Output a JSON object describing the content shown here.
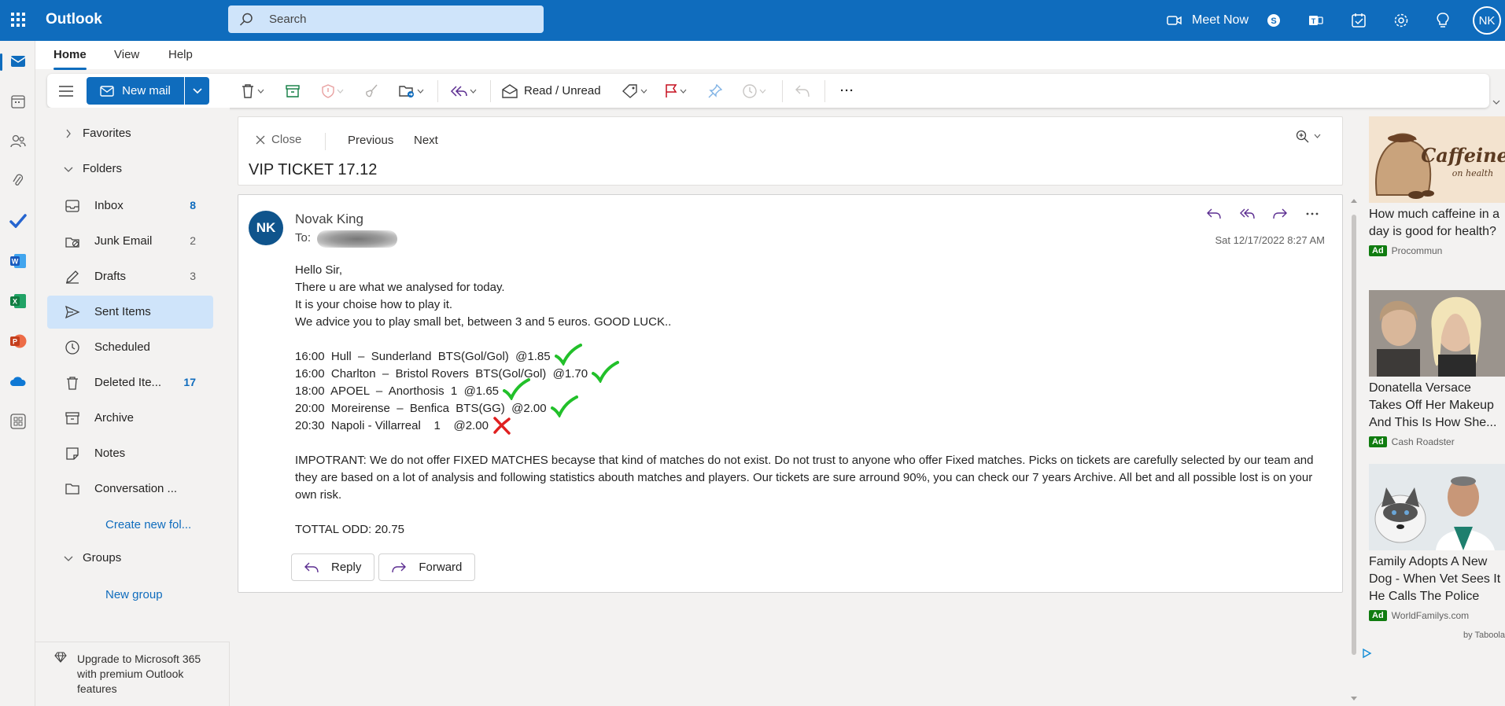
{
  "app": {
    "name": "Outlook"
  },
  "search": {
    "placeholder": "Search"
  },
  "topbar": {
    "meet_now": "Meet Now",
    "avatar": "NK"
  },
  "tabs": [
    {
      "label": "Home"
    },
    {
      "label": "View"
    },
    {
      "label": "Help"
    }
  ],
  "ribbon": {
    "new_mail": "New mail",
    "read_unread": "Read / Unread"
  },
  "folders": {
    "favorites_label": "Favorites",
    "folders_label": "Folders",
    "items": [
      {
        "label": "Inbox",
        "count": "8"
      },
      {
        "label": "Junk Email",
        "count": "2"
      },
      {
        "label": "Drafts",
        "count": "3"
      },
      {
        "label": "Sent Items",
        "count": ""
      },
      {
        "label": "Scheduled",
        "count": ""
      },
      {
        "label": "Deleted Ite...",
        "count": "17"
      },
      {
        "label": "Archive",
        "count": ""
      },
      {
        "label": "Notes",
        "count": ""
      },
      {
        "label": "Conversation ...",
        "count": ""
      }
    ],
    "create_new": "Create new fol...",
    "groups_label": "Groups",
    "new_group": "New group",
    "upgrade": "Upgrade to Microsoft 365 with premium Outlook features"
  },
  "reading": {
    "close": "Close",
    "previous": "Previous",
    "next": "Next",
    "subject": "VIP TICKET 17.12"
  },
  "message": {
    "avatar": "NK",
    "sender": "Novak King",
    "to_label": "To:",
    "date": "Sat 12/17/2022 8:27 AM",
    "greeting": "Hello Sir,",
    "line1": "There u are what we analysed for today.",
    "line2": "It is your choise how to play it.",
    "line3": "We advice you to play small bet, between 3 and 5 euros. GOOD LUCK..",
    "picks": [
      {
        "text": "16:00  Hull  –  Sunderland  BTS(Gol/Gol)  @1.85",
        "result": "win"
      },
      {
        "text": "16:00  Charlton  –  Bristol Rovers  BTS(Gol/Gol)  @1.70",
        "result": "win"
      },
      {
        "text": "18:00  APOEL  –  Anorthosis  1  @1.65",
        "result": "win"
      },
      {
        "text": "20:00  Moreirense  –  Benfica  BTS(GG)  @2.00",
        "result": "win"
      },
      {
        "text": "20:30  Napoli - Villarreal    1    @2.00",
        "result": "loss"
      }
    ],
    "important": "IMPOTRANT: We do not offer FIXED MATCHES becayse that kind of matches do not exist. Do not trust to anyone who offer Fixed matches. Picks on tickets are carefully selected by our team and they are based on a lot of analysis and following statistics abouth matches and players. Our tickets are sure arround 90%, you can check our 7 years Archive. All bet and all possible lost is on your own risk.",
    "total": "TOTTAL ODD: 20.75",
    "reply": "Reply",
    "forward": "Forward"
  },
  "ads": [
    {
      "title": "How much caffeine in a day is good for health?",
      "badge": "Ad",
      "source": "Procommun",
      "image_text_1": "Caffeine",
      "image_text_2": "on health"
    },
    {
      "title": "Donatella Versace Takes Off Her Makeup And This Is How She...",
      "badge": "Ad",
      "source": "Cash Roadster"
    },
    {
      "title": "Family Adopts A New Dog - When Vet Sees It He Calls The Police",
      "badge": "Ad",
      "source": "WorldFamilys.com"
    }
  ],
  "taboola": "by Taboola",
  "colors": {
    "brand": "#0f6cbd",
    "selected": "#cfe4fa",
    "win": "#22c02a",
    "loss": "#e02020"
  }
}
